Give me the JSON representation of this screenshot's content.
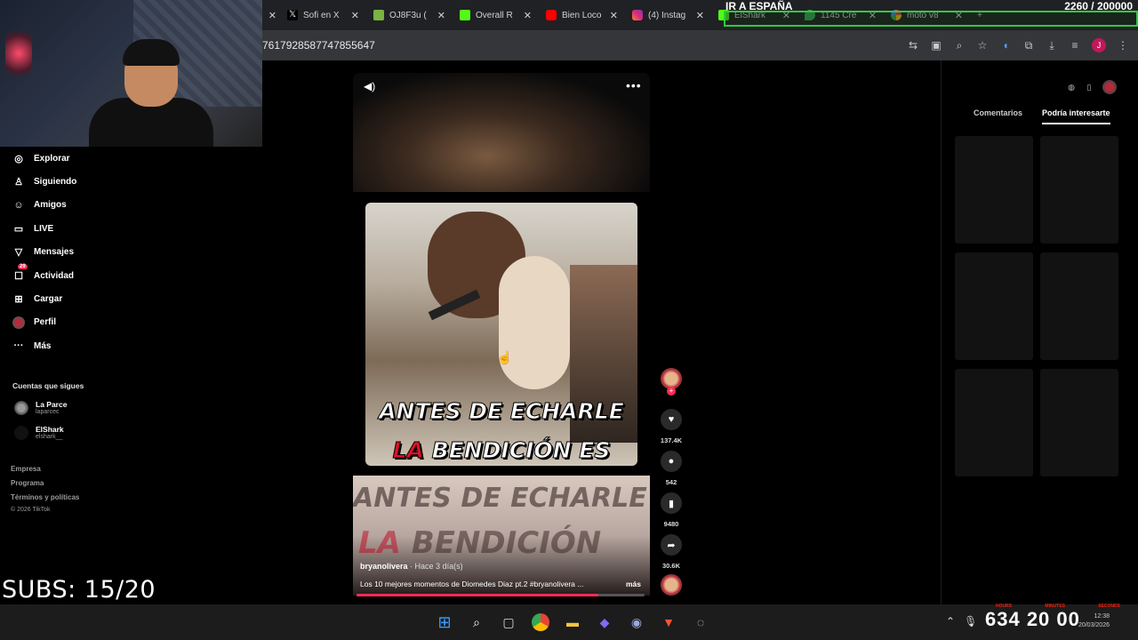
{
  "browser": {
    "tabs": [
      {
        "label": "",
        "icon": "close-icon",
        "color": "#202124"
      },
      {
        "label": "Sofi en X",
        "icon": "x-logo-icon",
        "color": "#000000"
      },
      {
        "label": "OJ8F3u (",
        "icon": "game-icon",
        "color": "#7cb342"
      },
      {
        "label": "Overall R",
        "icon": "kick-icon",
        "color": "#53fc18"
      },
      {
        "label": "Bien Loco",
        "icon": "youtube-icon",
        "color": "#ff0000"
      },
      {
        "label": "(4) Instag",
        "icon": "instagram-icon",
        "color": "#c13584"
      },
      {
        "label": "ElShark",
        "icon": "kick-icon",
        "color": "#53fc18"
      },
      {
        "label": "1145 Cre",
        "icon": "maps-icon",
        "color": "#34a853"
      },
      {
        "label": "moto v8",
        "icon": "google-icon",
        "color": "#4285f4"
      }
    ],
    "url": "7617928587747855647",
    "profile_initial": "J"
  },
  "goal": {
    "label": "IR A ESPAÑA",
    "progress": "2260 / 200000"
  },
  "sidebar": {
    "items": [
      {
        "label": "Explorar",
        "icon": "compass-icon"
      },
      {
        "label": "Siguiendo",
        "icon": "user-follow-icon"
      },
      {
        "label": "Amigos",
        "icon": "friends-icon"
      },
      {
        "label": "LIVE",
        "icon": "live-icon"
      },
      {
        "label": "Mensajes",
        "icon": "paper-plane-icon"
      },
      {
        "label": "Actividad",
        "icon": "activity-icon",
        "badge": "29"
      },
      {
        "label": "Cargar",
        "icon": "upload-icon"
      },
      {
        "label": "Perfil",
        "icon": "avatar"
      },
      {
        "label": "Más",
        "icon": "more-icon"
      }
    ],
    "following_title": "Cuentas que sigues",
    "following": [
      {
        "name": "La Parce",
        "handle": "laparcec"
      },
      {
        "name": "ElShark",
        "handle": "elshark__"
      }
    ],
    "footer": [
      "Empresa",
      "Programa",
      "Términos y políticas",
      "© 2026 TikTok"
    ]
  },
  "overlay": {
    "subs": "SUBS: 15/20"
  },
  "video": {
    "caption_line1": "ANTES DE ECHARLE",
    "caption_line2_red": "LA",
    "caption_line2": "BENDICIÓN ES",
    "bottom_blur1": "ANTES DE ECHARLE",
    "bottom_blur2_red": "LA",
    "bottom_blur2": "BENDICIÓN",
    "author": "bryanolivera",
    "time": "· Hace 3 día(s)",
    "description": "Los 10 mejores momentos de Diomedes Diaz pt.2 #bryanolivera ...",
    "more": "más",
    "progress_fraction": 0.84,
    "likes": "137.4K",
    "comments": "542",
    "saves": "9480",
    "shares": "30.6K"
  },
  "right_panel": {
    "tabs": [
      "Comentarios",
      "Podría interesarte"
    ],
    "active_tab": 1
  },
  "clock": {
    "big": "634 20 00",
    "labels": [
      "HOURS",
      "MINUTES",
      "SECONDS"
    ],
    "time": "12:38",
    "date": "20/03/2026"
  },
  "colors": {
    "accent": "#fe2c55",
    "goal_border": "#2ecc40"
  }
}
